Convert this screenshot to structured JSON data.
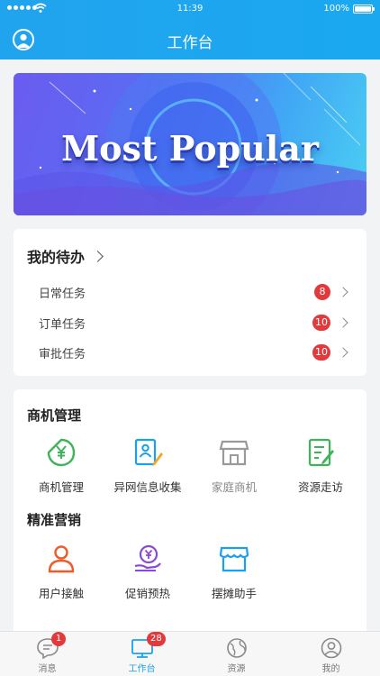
{
  "status_bar": {
    "time": "11:39",
    "battery": "100%"
  },
  "header": {
    "title": "工作台"
  },
  "banner": {
    "text": "Most Popular"
  },
  "todo": {
    "title": "我的待办",
    "items": [
      {
        "label": "日常任务",
        "count": "8"
      },
      {
        "label": "订单任务",
        "count": "10"
      },
      {
        "label": "审批任务",
        "count": "10"
      }
    ]
  },
  "business": {
    "title": "商机管理",
    "items": [
      {
        "label": "商机管理",
        "icon": "yuan-leaf-icon",
        "color": "#3fb35a"
      },
      {
        "label": "异网信息收集",
        "icon": "id-card-pen-icon",
        "color": "#1aa1ec"
      },
      {
        "label": "家庭商机",
        "icon": "shop-icon",
        "color": "#9a9a9a"
      },
      {
        "label": "资源走访",
        "icon": "document-edit-icon",
        "color": "#3fb35a"
      }
    ]
  },
  "marketing": {
    "title": "精准营销",
    "items": [
      {
        "label": "用户接触",
        "icon": "user-icon",
        "color": "#f05a28"
      },
      {
        "label": "促销预热",
        "icon": "coin-hand-icon",
        "color": "#8a49d6"
      },
      {
        "label": "摆摊助手",
        "icon": "stall-icon",
        "color": "#1aa1ec"
      }
    ]
  },
  "tabbar": {
    "tabs": [
      {
        "label": "消息",
        "badge": "1"
      },
      {
        "label": "工作台",
        "badge": "28"
      },
      {
        "label": "资源",
        "badge": ""
      },
      {
        "label": "我的",
        "badge": ""
      }
    ],
    "active_color": "#1aa1ec"
  }
}
